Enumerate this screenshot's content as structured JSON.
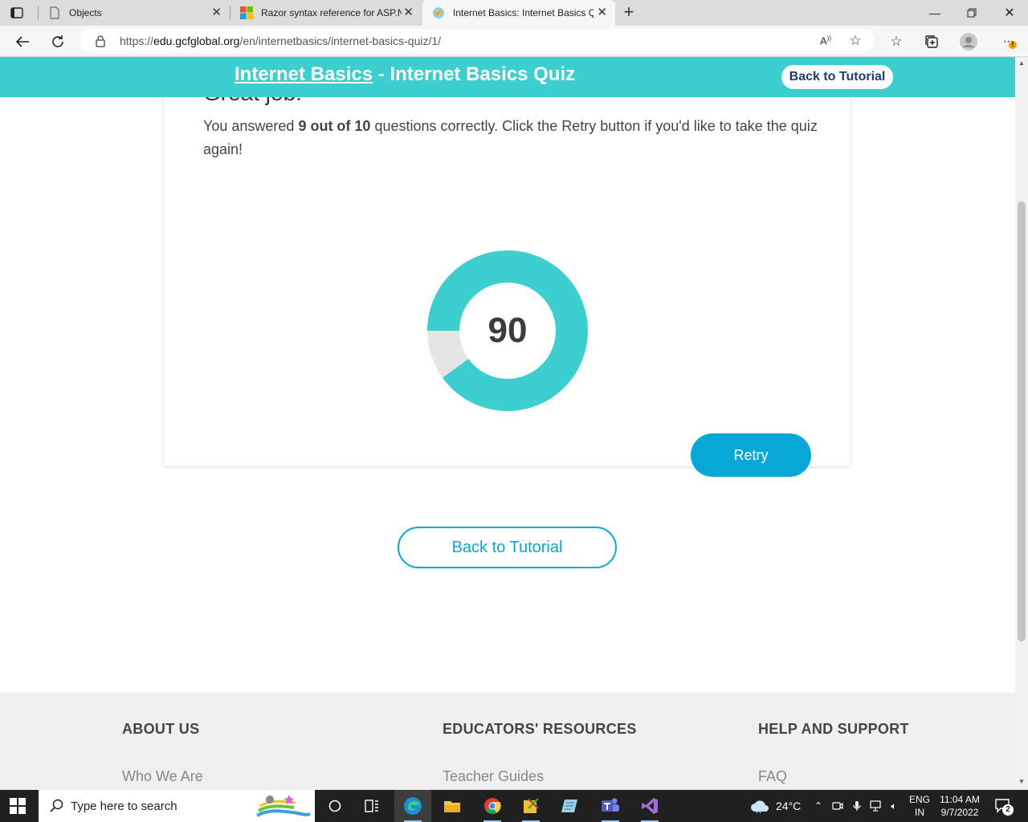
{
  "browser": {
    "tabs": [
      {
        "title": "Objects"
      },
      {
        "title": "Razor syntax reference for ASP.N"
      },
      {
        "title": "Internet Basics: Internet Basics Q"
      }
    ],
    "url_prefix": "https://",
    "url_host": "edu.gcfglobal.org",
    "url_path": "/en/internetbasics/internet-basics-quiz/1/"
  },
  "header": {
    "course_link": "Internet Basics",
    "separator": " - ",
    "quiz_title": "Internet Basics Quiz",
    "back_button": "Back to Tutorial"
  },
  "result": {
    "heading": "Great job!",
    "text_before": "You answered ",
    "score_bold": "9 out of 10",
    "text_after": " questions correctly. Click the Retry button if you'd like to take the quiz again!",
    "score_value": "90",
    "score_fraction": 0.9,
    "ring_color": "#3bcfcf",
    "ring_remainder_color": "#e5e5e5",
    "retry_label": "Retry"
  },
  "back_to_tutorial_label": "Back to Tutorial",
  "footer": {
    "columns": [
      {
        "heading": "ABOUT US",
        "first_link": "Who We Are"
      },
      {
        "heading": "EDUCATORS' RESOURCES",
        "first_link": "Teacher Guides"
      },
      {
        "heading": "HELP AND SUPPORT",
        "first_link": "FAQ"
      }
    ]
  },
  "taskbar": {
    "search_placeholder": "Type here to search",
    "temperature": "24°C",
    "lang_line1": "ENG",
    "lang_line2": "IN",
    "time": "11:04 AM",
    "date": "9/7/2022",
    "notification_count": "2"
  }
}
